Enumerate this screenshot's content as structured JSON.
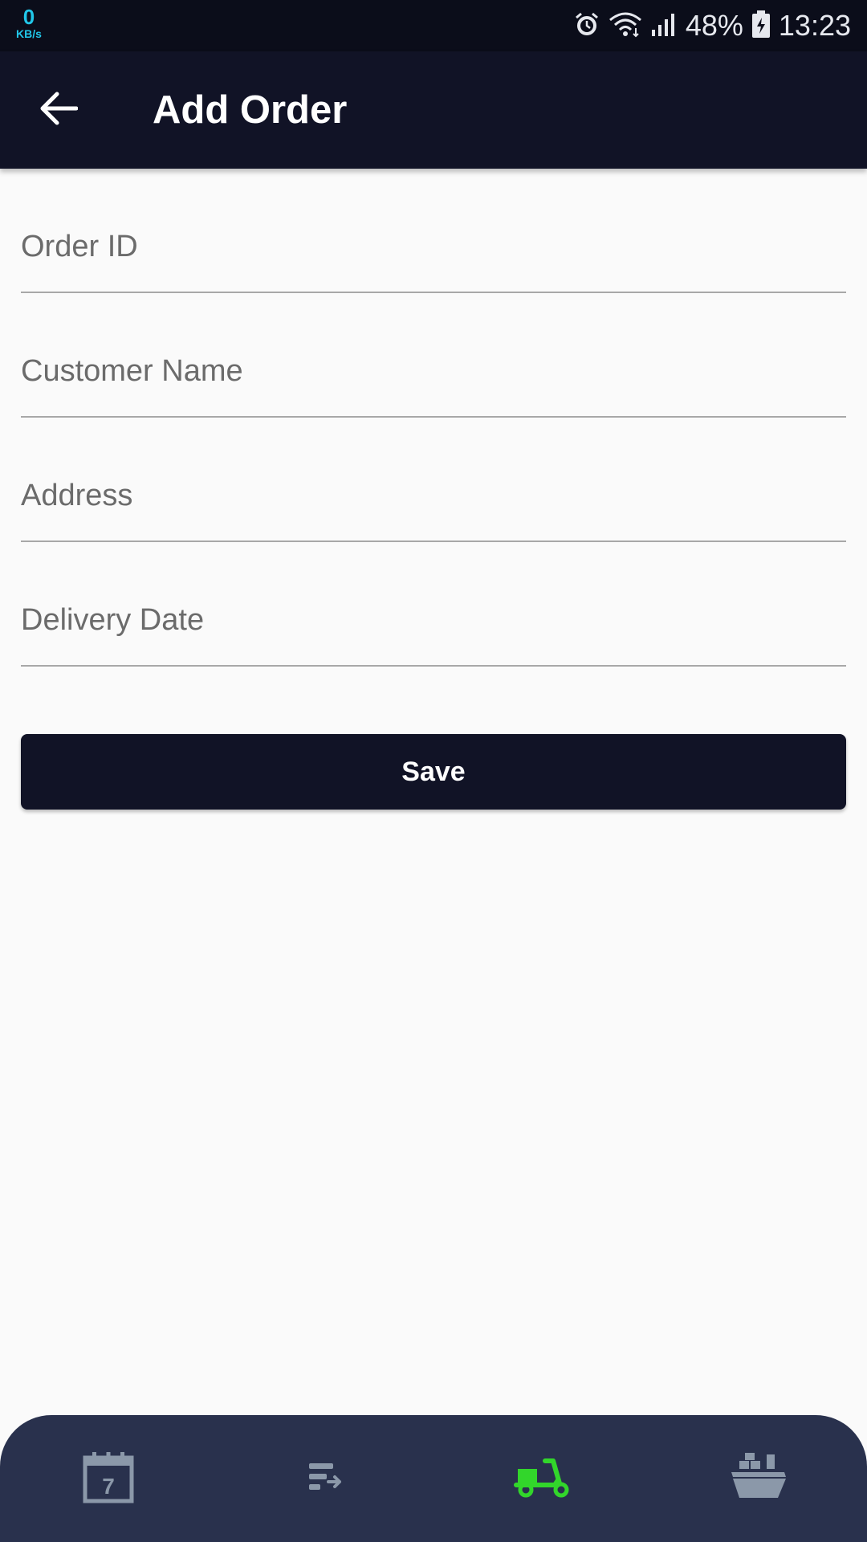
{
  "status_bar": {
    "net_speed": "0",
    "net_unit": "KB/s",
    "battery": "48%",
    "time": "13:23"
  },
  "app_bar": {
    "title": "Add Order"
  },
  "form": {
    "order_id_placeholder": "Order ID",
    "customer_name_placeholder": "Customer Name",
    "address_placeholder": "Address",
    "delivery_date_placeholder": "Delivery Date",
    "save_label": "Save"
  },
  "bottom_nav": {
    "items": [
      {
        "icon": "calendar-icon",
        "day": "7",
        "active": false
      },
      {
        "icon": "list-export-icon",
        "active": false
      },
      {
        "icon": "scooter-icon",
        "active": true
      },
      {
        "icon": "ship-icon",
        "active": false
      }
    ],
    "active_color": "#32d62b",
    "inactive_color": "#8b98a9"
  },
  "colors": {
    "primary": "#111326",
    "nav_background": "#29314d",
    "page_background": "#fafafa"
  }
}
